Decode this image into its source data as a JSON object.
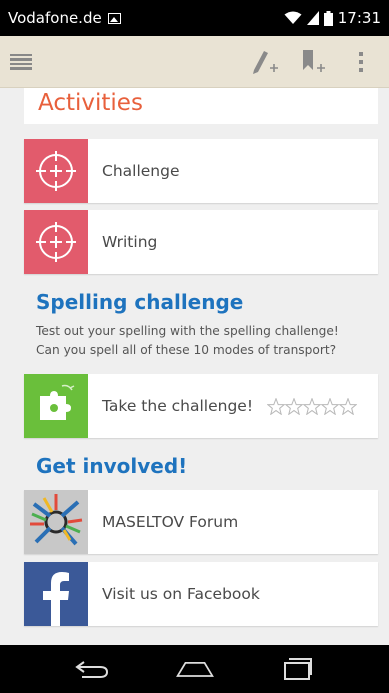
{
  "status_bar": {
    "carrier": "Vodafone.de",
    "time": "17:31",
    "icons": [
      "image-notification-icon",
      "wifi-icon",
      "signal-icon",
      "battery-icon"
    ]
  },
  "action_bar": {
    "icons": [
      "menu-icon",
      "add-note-icon",
      "add-bookmark-icon",
      "overflow-menu-icon"
    ]
  },
  "activities": {
    "title": "Activities",
    "items": [
      {
        "label": "Challenge",
        "icon": "crosshair-plus-icon"
      },
      {
        "label": "Writing",
        "icon": "crosshair-plus-icon"
      }
    ]
  },
  "spelling": {
    "title": "Spelling challenge",
    "desc1": "Test out your spelling with the spelling challenge!",
    "desc2": "Can you spell all of these 10 modes of transport?",
    "card_label": "Take the challenge!",
    "rating": 0,
    "max_rating": 5,
    "icon": "puzzle-icon"
  },
  "involved": {
    "title": "Get involved!",
    "items": [
      {
        "label": "MASELTOV Forum",
        "icon": "maseltov-logo-icon"
      },
      {
        "label": "Visit us on Facebook",
        "icon": "facebook-icon"
      }
    ]
  },
  "nav_bar": {
    "icons": [
      "back-icon",
      "home-icon",
      "recent-apps-icon"
    ]
  },
  "colors": {
    "accent_orange": "#e8603c",
    "section_blue": "#1e73be",
    "activity_pink": "#e25b6c",
    "puzzle_green": "#6abf3b",
    "facebook_blue": "#3b5998",
    "action_bar_bg": "#e9e3d4"
  }
}
